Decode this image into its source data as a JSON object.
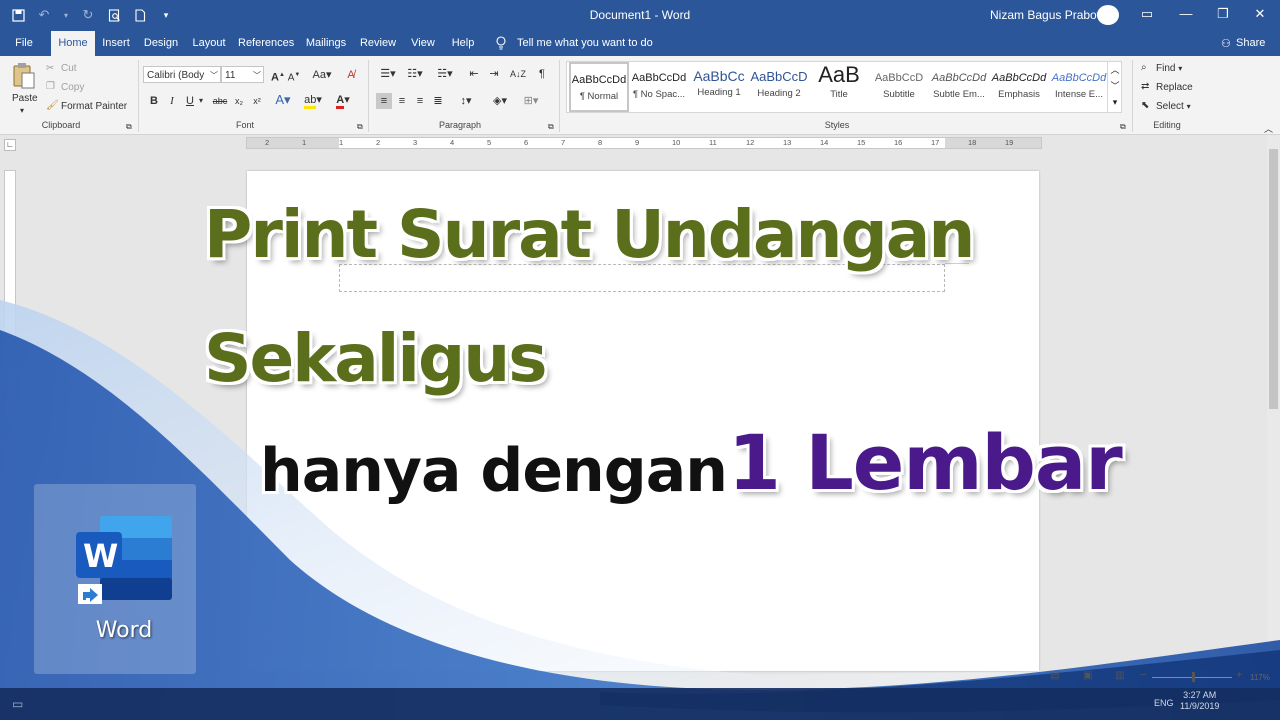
{
  "title_bar": {
    "document_title": "Document1  -  Word",
    "user_name": "Nizam Bagus Prabowo"
  },
  "menu": {
    "tabs": [
      "File",
      "Home",
      "Insert",
      "Design",
      "Layout",
      "References",
      "Mailings",
      "Review",
      "View",
      "Help"
    ],
    "active_tab": "Home",
    "tell_me": "Tell me what you want to do",
    "share": "Share"
  },
  "ribbon": {
    "clipboard": {
      "paste": "Paste",
      "cut": "Cut",
      "copy": "Copy",
      "format_painter": "Format Painter",
      "label": "Clipboard"
    },
    "font": {
      "name": "Calibri (Body",
      "size": "11",
      "label": "Font"
    },
    "paragraph": {
      "label": "Paragraph"
    },
    "styles": {
      "items": [
        {
          "preview": "AaBbCcDd",
          "name": "¶ Normal"
        },
        {
          "preview": "AaBbCcDd",
          "name": "¶ No Spac..."
        },
        {
          "preview": "AaBbCc",
          "name": "Heading 1"
        },
        {
          "preview": "AaBbCcD",
          "name": "Heading 2"
        },
        {
          "preview": "AaB",
          "name": "Title"
        },
        {
          "preview": "AaBbCcD",
          "name": "Subtitle"
        },
        {
          "preview": "AaBbCcDd",
          "name": "Subtle Em..."
        },
        {
          "preview": "AaBbCcDd",
          "name": "Emphasis"
        },
        {
          "preview": "AaBbCcDd",
          "name": "Intense E..."
        }
      ],
      "label": "Styles"
    },
    "editing": {
      "find": "Find",
      "replace": "Replace",
      "select": "Select",
      "label": "Editing"
    }
  },
  "ruler": {
    "numbers": [
      "2",
      "1",
      "1",
      "2",
      "3",
      "4",
      "5",
      "6",
      "7",
      "8",
      "9",
      "10",
      "11",
      "12",
      "13",
      "14",
      "15",
      "16",
      "17",
      "18",
      "19"
    ]
  },
  "overlay": {
    "line1": "Print Surat Undangan",
    "line2": "Sekaligus",
    "line3a": "hanya dengan",
    "line3b": "1 Lembar",
    "desktop_icon_label": "Word"
  },
  "status": {
    "zoom": "117%",
    "language": "ENG",
    "time": "3:27 AM",
    "date": "11/9/2019"
  }
}
